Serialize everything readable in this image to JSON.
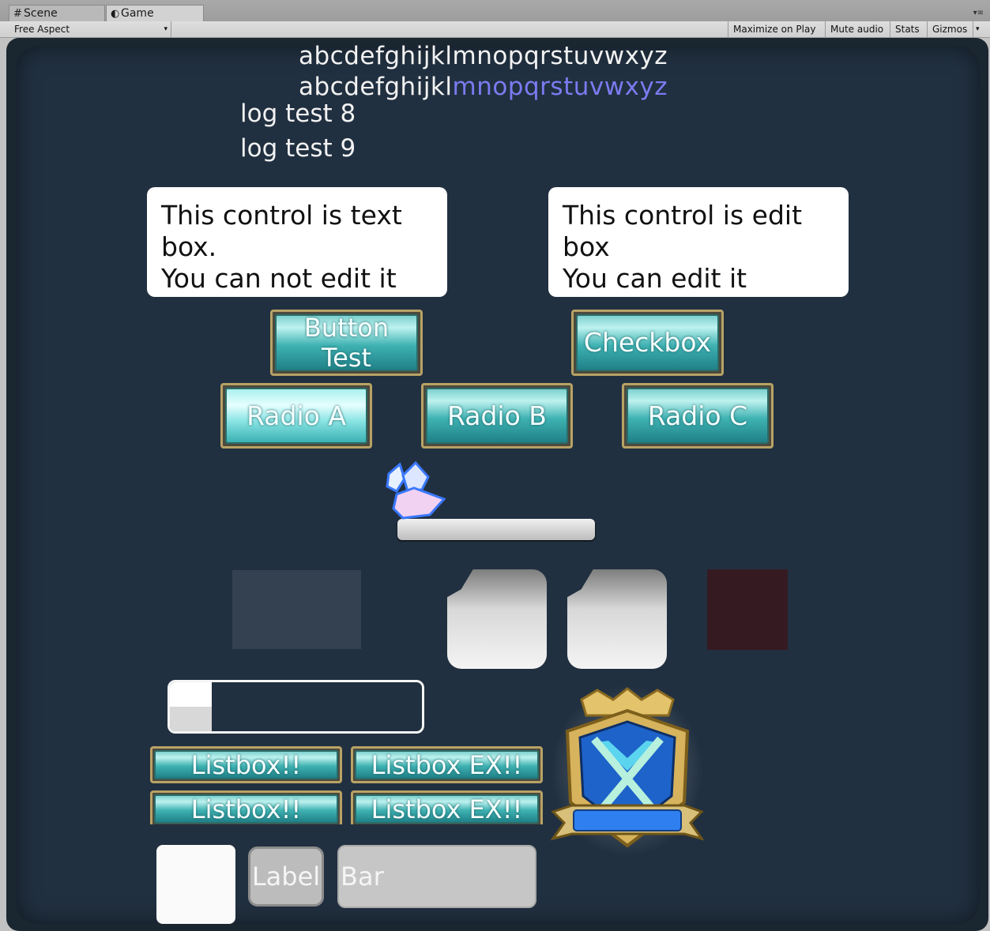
{
  "editor": {
    "tabs": [
      {
        "label": "Scene",
        "icon": "grid-icon"
      },
      {
        "label": "Game",
        "icon": "pacman-icon"
      }
    ],
    "aspect": "Free Aspect",
    "toolbar": [
      "Maximize on Play",
      "Mute audio",
      "Stats",
      "Gizmos"
    ]
  },
  "game": {
    "alphabet_line1": "abcdefghijklmnopqrstuvwxyz",
    "alphabet_line2_a": "abcdefghijkl",
    "alphabet_line2_b": "mnopqrstuvwxyz",
    "highlight_color": "#7b7bf0",
    "logs": [
      "log test 8",
      "log test 9"
    ],
    "textbox": "This control is text box.\nYou can not edit it",
    "editbox": "This control is edit box\nYou can edit it",
    "buttons": {
      "button_test": "Button Test",
      "checkbox": "Checkbox"
    },
    "radios": [
      "Radio A",
      "Radio B",
      "Radio C"
    ],
    "slider_value": 0,
    "progress_value": 0.1,
    "listbox": [
      [
        "Listbox!!",
        "Listbox EX!!"
      ],
      [
        "Listbox!!",
        "Listbox EX!!"
      ]
    ],
    "label": "Label",
    "bar": "Bar",
    "colors": {
      "frame": "#b8a265",
      "button_teal": "#3fb2b2",
      "background": "#213040",
      "dark_red": "#361a22"
    }
  }
}
